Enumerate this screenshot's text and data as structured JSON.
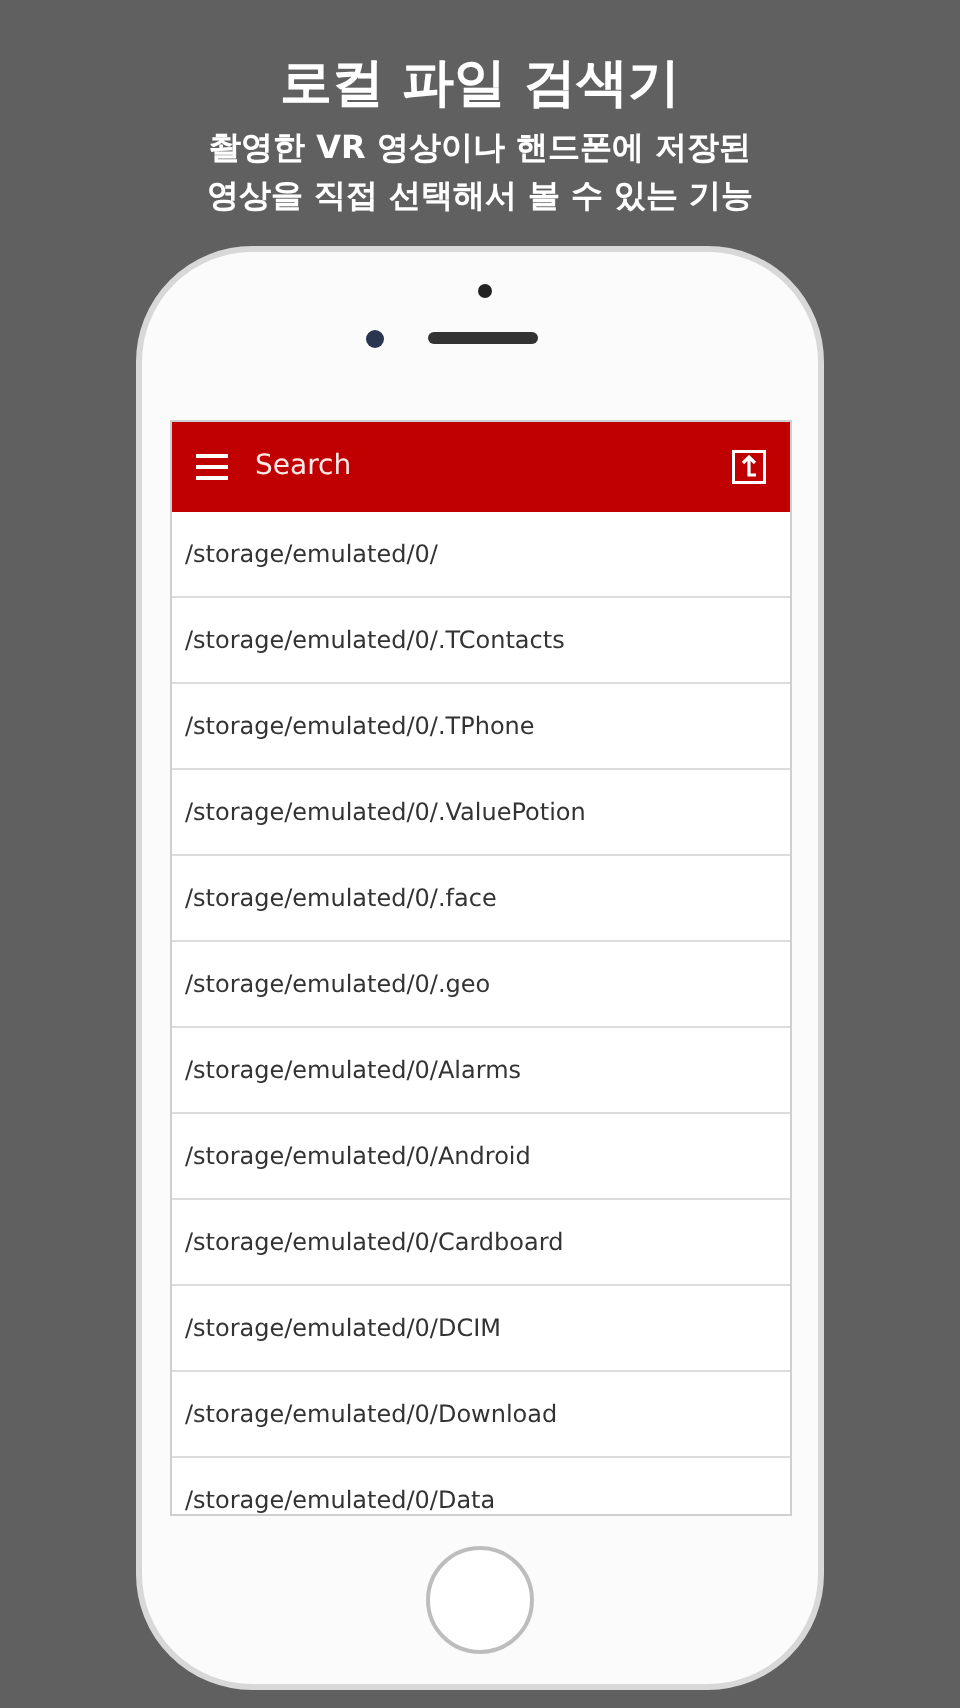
{
  "headline": {
    "title": "로컬 파일 검색기",
    "subtitle_lines": [
      "촬영한 VR 영상이나 핸드폰에 저장된",
      "영상을 직접 선택해서 볼 수 있는 기능"
    ]
  },
  "app_bar": {
    "title": "Search"
  },
  "paths": [
    "/storage/emulated/0/",
    "/storage/emulated/0/.TContacts",
    "/storage/emulated/0/.TPhone",
    "/storage/emulated/0/.ValuePotion",
    "/storage/emulated/0/.face",
    "/storage/emulated/0/.geo",
    "/storage/emulated/0/Alarms",
    "/storage/emulated/0/Android",
    "/storage/emulated/0/Cardboard",
    "/storage/emulated/0/DCIM",
    "/storage/emulated/0/Download",
    "/storage/emulated/0/Data"
  ]
}
